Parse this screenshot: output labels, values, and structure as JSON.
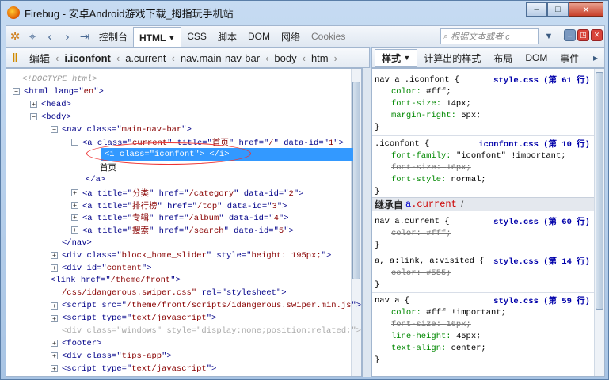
{
  "window": {
    "title": "Firebug - 安卓Android游戏下载_拇指玩手机站"
  },
  "toolbar": {
    "tabs": [
      "控制台",
      "HTML",
      "CSS",
      "脚本",
      "DOM",
      "网络",
      "Cookies"
    ],
    "html_arrow": "▼",
    "search_placeholder": "根据文本或者 c"
  },
  "breadcrumb": {
    "edit_label": "编辑",
    "items": [
      "i.iconfont",
      "a.current",
      "nav.main-nav-bar",
      "body",
      "htm"
    ]
  },
  "side_tabs": [
    "样式",
    "计算出的样式",
    "布局",
    "DOM",
    "事件"
  ],
  "html_lines": [
    {
      "t": "<!DOCTYPE html>"
    },
    {
      "tag": "html",
      "attrs": [
        [
          "lang",
          "en"
        ]
      ]
    },
    {
      "tag": "head"
    },
    {
      "tag": "body"
    },
    {
      "tag": "nav",
      "attrs": [
        [
          "class",
          "main-nav-bar"
        ]
      ]
    },
    {
      "tag": "a",
      "attrs": [
        [
          "class",
          "current"
        ],
        [
          "title",
          "首页"
        ],
        [
          "href",
          "/"
        ],
        [
          "data-id",
          "1"
        ]
      ]
    },
    {
      "sel": "<i class=\"iconfont\">  </i>"
    },
    {
      "text": "首页"
    },
    {
      "close": "</a>"
    },
    {
      "tag": "a",
      "attrs": [
        [
          "title",
          "分类"
        ],
        [
          "href",
          "/category"
        ],
        [
          "data-id",
          "2"
        ]
      ]
    },
    {
      "tag": "a",
      "attrs": [
        [
          "title",
          "排行榜"
        ],
        [
          "href",
          "/top"
        ],
        [
          "data-id",
          "3"
        ]
      ]
    },
    {
      "tag": "a",
      "attrs": [
        [
          "title",
          "专辑"
        ],
        [
          "href",
          "/album"
        ],
        [
          "data-id",
          "4"
        ]
      ]
    },
    {
      "tag": "a",
      "attrs": [
        [
          "title",
          "搜索"
        ],
        [
          "href",
          "/search"
        ],
        [
          "data-id",
          "5"
        ]
      ]
    },
    {
      "close": "</nav>"
    },
    {
      "tag": "div",
      "attrs": [
        [
          "class",
          "block_home_slider"
        ],
        [
          "style",
          "height: 195px;"
        ]
      ]
    },
    {
      "tag": "div",
      "attrs": [
        [
          "id",
          "content"
        ]
      ]
    },
    {
      "tag": "link",
      "attrs": [
        [
          "href",
          "/theme/front"
        ]
      ]
    },
    {
      "cont": "/css/idangerous.swiper.css\"",
      "rest": " rel=\"stylesheet\">"
    },
    {
      "tag": "script",
      "attrs": [
        [
          "src",
          "/theme/front/scripts/idangerous.swiper.min.js"
        ]
      ]
    },
    {
      "tag": "script",
      "attrs": [
        [
          "type",
          "text/javascript"
        ]
      ]
    },
    {
      "dim": "<div class=\"windows\" style=\"display:none;position:related;\">"
    },
    {
      "tag": "footer"
    },
    {
      "tag": "div",
      "attrs": [
        [
          "class",
          "tips-app"
        ]
      ]
    },
    {
      "tag": "script",
      "attrs": [
        [
          "type",
          "text/javascript"
        ]
      ]
    }
  ],
  "styles": {
    "inherit_label": "继承自",
    "inherit_a": "a",
    "inherit_cls": ".current",
    "rule1_sel": "nav a .iconfont {",
    "rule1_src": "style.css (第 61 行)",
    "r1p1": "color:",
    "r1v1": "#fff;",
    "r1p2": "font-size:",
    "r1v2": "14px;",
    "r1p3": "margin-right:",
    "r1v3": "5px;",
    "rule2_sel": ".iconfont {",
    "rule2_src": "iconfont.css (第 10 行)",
    "r2p1": "font-family:",
    "r2v1": "\"iconfont\" !important;",
    "r2p2": "font-size:",
    "r2v2": "16px;",
    "r2p3": "font-style:",
    "r2v3": "normal;",
    "rule3_sel": "nav a.current {",
    "rule3_src": "style.css (第 60 行)",
    "r3p1": "color:",
    "r3v1": "#fff;",
    "rule4_sel": "a, a:link, a:visited {",
    "rule4_src": "style.css (第 14 行)",
    "r4p1": "color:",
    "r4v1": "#555;",
    "rule5_sel": "nav a {",
    "rule5_src": "style.css (第 59 行)",
    "r5p1": "color:",
    "r5v1": "#fff !important;",
    "r5p2": "font-size:",
    "r5v2": "16px;",
    "r5p3": "line-height:",
    "r5v3": "45px;",
    "r5p4": "text-align:",
    "r5v4": "center;",
    "close": "}"
  }
}
